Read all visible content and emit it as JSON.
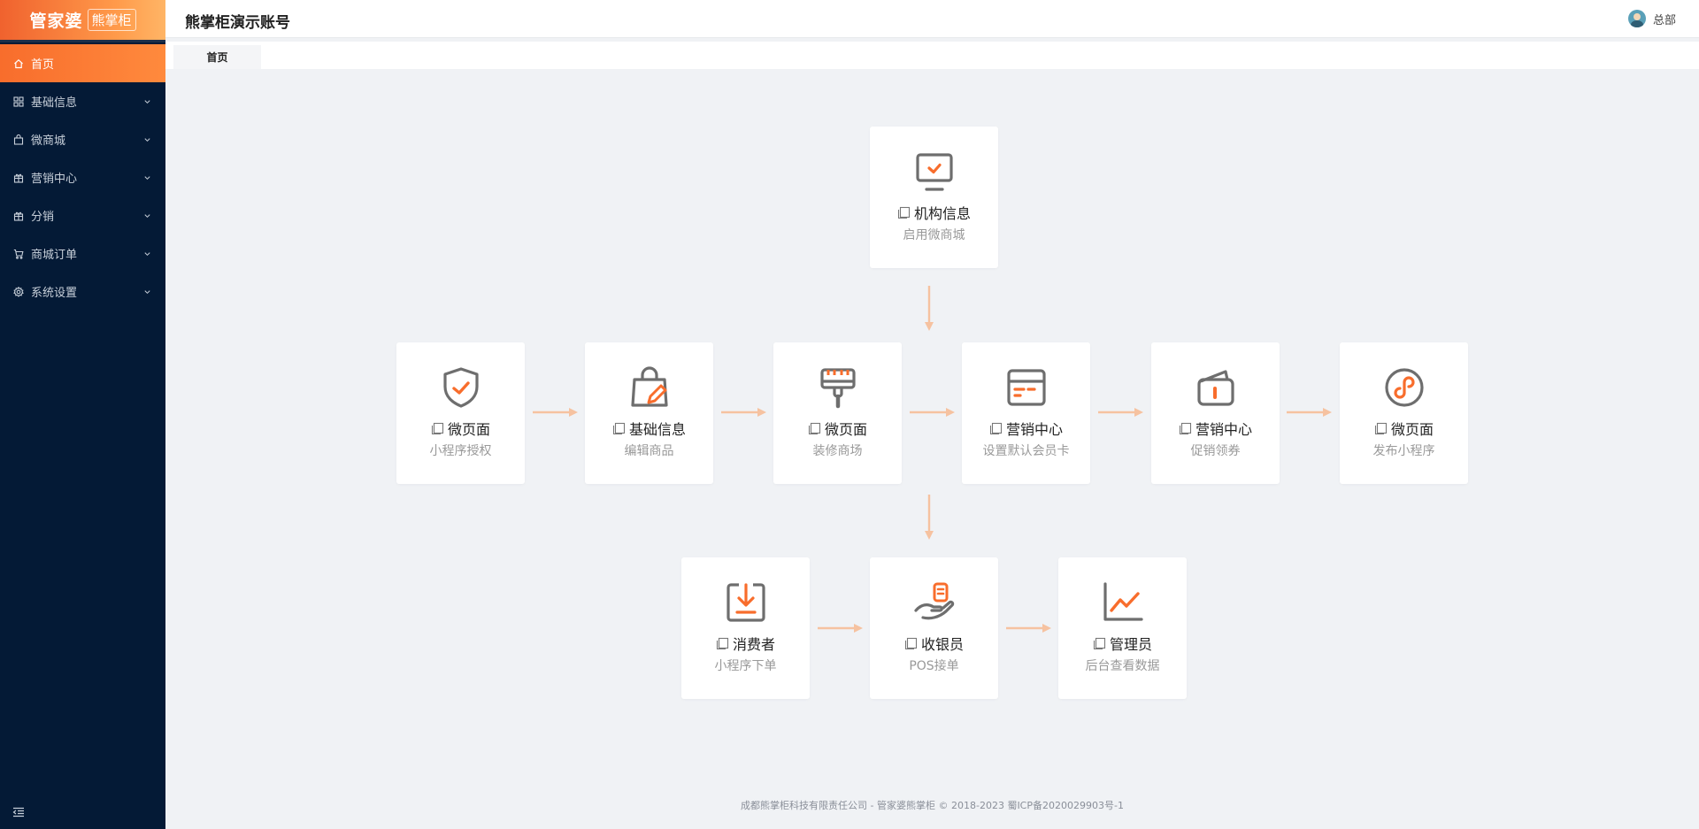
{
  "logo": {
    "brand": "管家婆",
    "sub": "熊掌柜"
  },
  "sidebar": {
    "items": [
      {
        "label": "首页",
        "icon": "home-icon",
        "active": true
      },
      {
        "label": "基础信息",
        "icon": "grid-icon"
      },
      {
        "label": "微商城",
        "icon": "bag-icon"
      },
      {
        "label": "营销中心",
        "icon": "gift-icon"
      },
      {
        "label": "分销",
        "icon": "gift-icon"
      },
      {
        "label": "商城订单",
        "icon": "cart-icon"
      },
      {
        "label": "系统设置",
        "icon": "gear-icon"
      }
    ]
  },
  "header": {
    "title": "熊掌柜演示账号",
    "user": "总部"
  },
  "tabs": [
    {
      "label": "首页"
    }
  ],
  "flow": {
    "org": {
      "title": "机构信息",
      "sub": "启用微商城"
    },
    "row1": [
      {
        "title": "微页面",
        "sub": "小程序授权"
      },
      {
        "title": "基础信息",
        "sub": "编辑商品"
      },
      {
        "title": "微页面",
        "sub": "装修商场"
      },
      {
        "title": "营销中心",
        "sub": "设置默认会员卡"
      },
      {
        "title": "营销中心",
        "sub": "促销领券"
      },
      {
        "title": "微页面",
        "sub": "发布小程序"
      }
    ],
    "row2": [
      {
        "title": "消费者",
        "sub": "小程序下单"
      },
      {
        "title": "收银员",
        "sub": "POS接单"
      },
      {
        "title": "管理员",
        "sub": "后台查看数据"
      }
    ]
  },
  "footer": "成都熊掌柜科技有限责任公司 - 管家婆熊掌柜 © 2018-2023 蜀ICP备2020029903号-1",
  "colors": {
    "accent": "#f86d2c",
    "sidebar": "#041a36",
    "icon_gray": "#6e6e6e",
    "arrow": "#f6c2a0"
  }
}
